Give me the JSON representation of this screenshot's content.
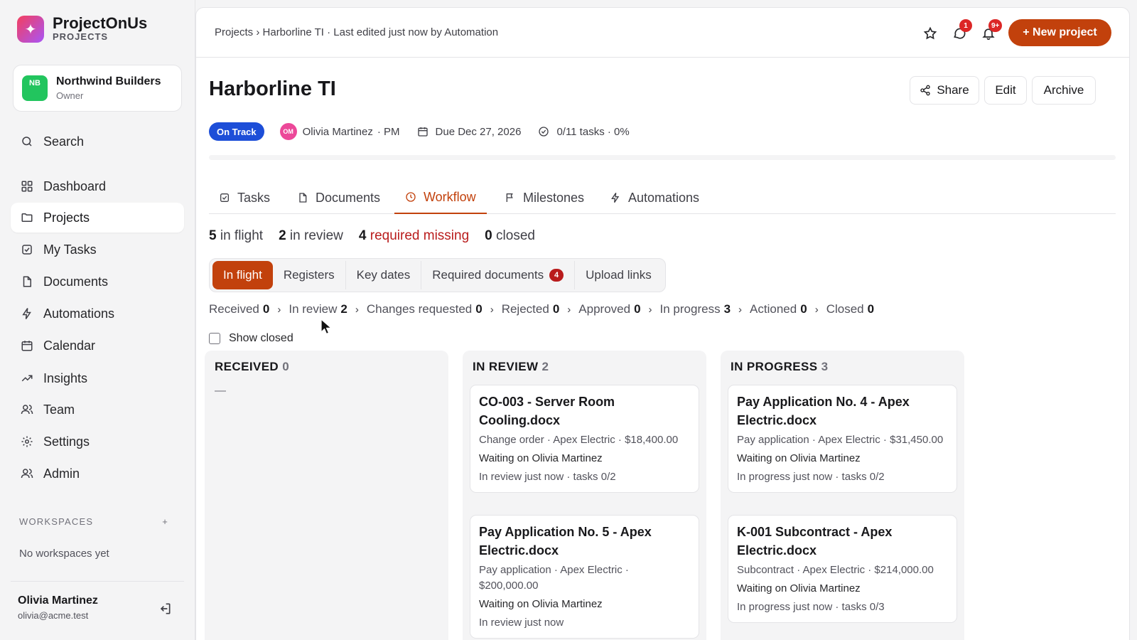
{
  "brand": {
    "name": "ProjectOnUs",
    "subtitle": "PROJECTS",
    "logo_glyph": "✦"
  },
  "org": {
    "initials": "NB",
    "name": "Northwind Builders",
    "role": "Owner"
  },
  "sidebar": {
    "items": [
      {
        "label": "Search",
        "icon": "search-icon"
      },
      {
        "label": "Dashboard",
        "icon": "grid-icon"
      },
      {
        "label": "Projects",
        "icon": "folder-icon",
        "active": true
      },
      {
        "label": "My Tasks",
        "icon": "checkbox-icon"
      },
      {
        "label": "Documents",
        "icon": "file-icon"
      },
      {
        "label": "Automations",
        "icon": "bolt-icon"
      },
      {
        "label": "Calendar",
        "icon": "calendar-icon"
      },
      {
        "label": "Insights",
        "icon": "trend-icon"
      },
      {
        "label": "Team",
        "icon": "users-icon"
      },
      {
        "label": "Settings",
        "icon": "gear-icon"
      },
      {
        "label": "Admin",
        "icon": "users-icon"
      }
    ],
    "workspaces_title": "WORKSPACES",
    "workspaces_add": "+",
    "workspaces_empty": "No workspaces yet"
  },
  "user": {
    "name": "Olivia Martinez",
    "email": "olivia@acme.test"
  },
  "topbar": {
    "breadcrumb": "Projects › Harborline TI · Last edited just now by Automation",
    "messages_badge": "1",
    "notifications_badge": "9+",
    "new_project_label": "+ New project"
  },
  "project": {
    "title": "Harborline TI",
    "actions": {
      "share": "Share",
      "edit": "Edit",
      "archive": "Archive"
    },
    "status": "On Track",
    "pm_initials": "OM",
    "pm_name": "Olivia Martinez",
    "pm_role": "· PM",
    "due": "Due Dec 27, 2026",
    "tasks_summary": "0/11 tasks · 0%",
    "progress_percent": 0
  },
  "tabs": [
    {
      "label": "Tasks",
      "icon": "checkbox-icon"
    },
    {
      "label": "Documents",
      "icon": "file-icon"
    },
    {
      "label": "Workflow",
      "icon": "clock-icon",
      "active": true
    },
    {
      "label": "Milestones",
      "icon": "flag-icon"
    },
    {
      "label": "Automations",
      "icon": "bolt-icon"
    }
  ],
  "counts": {
    "in_flight_n": "5",
    "in_flight_label": "in flight",
    "in_review_n": "2",
    "in_review_label": "in review",
    "missing_n": "4",
    "missing_label": "required missing",
    "closed_n": "0",
    "closed_label": "closed"
  },
  "segments": [
    {
      "label": "In flight",
      "active": true
    },
    {
      "label": "Registers"
    },
    {
      "label": "Key dates"
    },
    {
      "label": "Required documents",
      "badge": "4"
    },
    {
      "label": "Upload links"
    }
  ],
  "pipeline": [
    {
      "label": "Received",
      "count": "0"
    },
    {
      "label": "In review",
      "count": "2"
    },
    {
      "label": "Changes requested",
      "count": "0"
    },
    {
      "label": "Rejected",
      "count": "0"
    },
    {
      "label": "Approved",
      "count": "0"
    },
    {
      "label": "In progress",
      "count": "3"
    },
    {
      "label": "Actioned",
      "count": "0"
    },
    {
      "label": "Closed",
      "count": "0"
    }
  ],
  "show_closed_label": "Show closed",
  "board": {
    "received": {
      "title": "RECEIVED",
      "count": "0",
      "empty": "—"
    },
    "in_review": {
      "title": "IN REVIEW",
      "count": "2",
      "cards": [
        {
          "title": "CO-003 - Server Room Cooling.docx",
          "sub": "Change order · Apex Electric · $18,400.00",
          "waiting": "Waiting on Olivia Martinez",
          "foot": "In review just now · tasks 0/2"
        },
        {
          "title": "Pay Application No. 5 - Apex Electric.docx",
          "sub": "Pay application · Apex Electric · $200,000.00",
          "waiting": "Waiting on Olivia Martinez",
          "foot": "In review just now"
        }
      ]
    },
    "in_progress": {
      "title": "IN PROGRESS",
      "count": "3",
      "cards": [
        {
          "title": "Pay Application No. 4 - Apex Electric.docx",
          "sub": "Pay application · Apex Electric · $31,450.00",
          "waiting": "Waiting on Olivia Martinez",
          "foot": "In progress just now · tasks 0/2"
        },
        {
          "title": "K-001 Subcontract - Apex Electric.docx",
          "sub": "Subcontract · Apex Electric · $214,000.00",
          "waiting": "Waiting on Olivia Martinez",
          "foot": "In progress just now · tasks 0/3"
        }
      ]
    }
  },
  "colors": {
    "accent": "#c2410c",
    "status": "#1d4ed8",
    "danger": "#b91c1c"
  }
}
